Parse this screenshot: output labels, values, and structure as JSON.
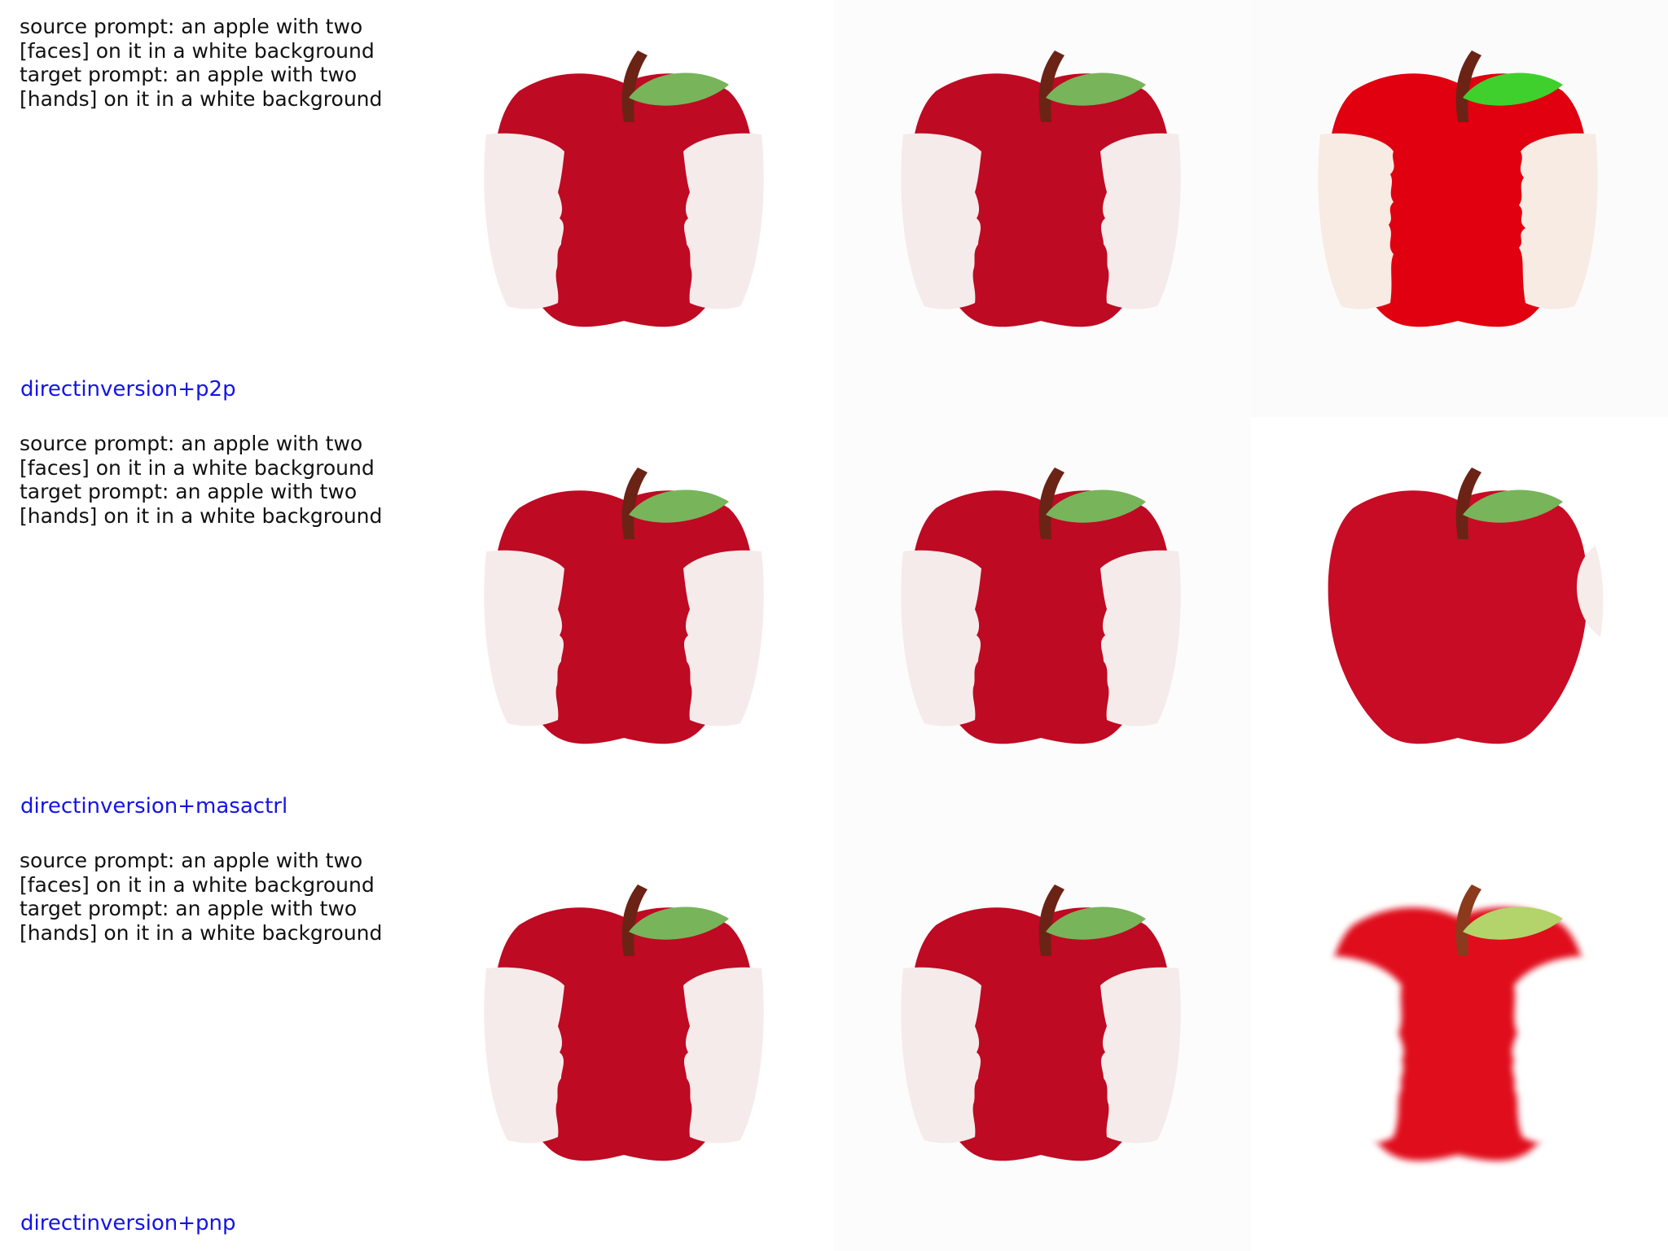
{
  "rows": [
    {
      "source_prompt": "source prompt: an apple with two\n[faces] on it in a white background",
      "target_prompt": "target prompt: an apple with two\n[hands] on it in a white background",
      "method": "directinversion+p2p"
    },
    {
      "source_prompt": "source prompt: an apple with two\n[faces] on it in a white background",
      "target_prompt": "target prompt: an apple with two\n[hands] on it in a white background",
      "method": "directinversion+masactrl"
    },
    {
      "source_prompt": "source prompt: an apple with two\n[faces] on it in a white background",
      "target_prompt": "target prompt: an apple with two\n[hands] on it in a white background",
      "method": "directinversion+pnp"
    }
  ],
  "colors": {
    "method_label": "#1414e6",
    "prompt_text": "#111111",
    "apple_red": "#be0a23",
    "apple_bright_red": "#e0000f",
    "flesh": "#f6ebeb",
    "leaf": "#78b45a",
    "leaf_bright": "#3fd02e",
    "stem": "#6b2316"
  },
  "images": {
    "row1": [
      "apple-core-two-faces",
      "apple-core-two-faces",
      "apple-core-two-faces-jagged-bright"
    ],
    "row2": [
      "apple-core-two-faces",
      "apple-core-two-faces",
      "whole-apple-with-bite"
    ],
    "row3": [
      "apple-core-two-faces",
      "apple-core-two-faces",
      "apple-core-soft-edges"
    ]
  }
}
